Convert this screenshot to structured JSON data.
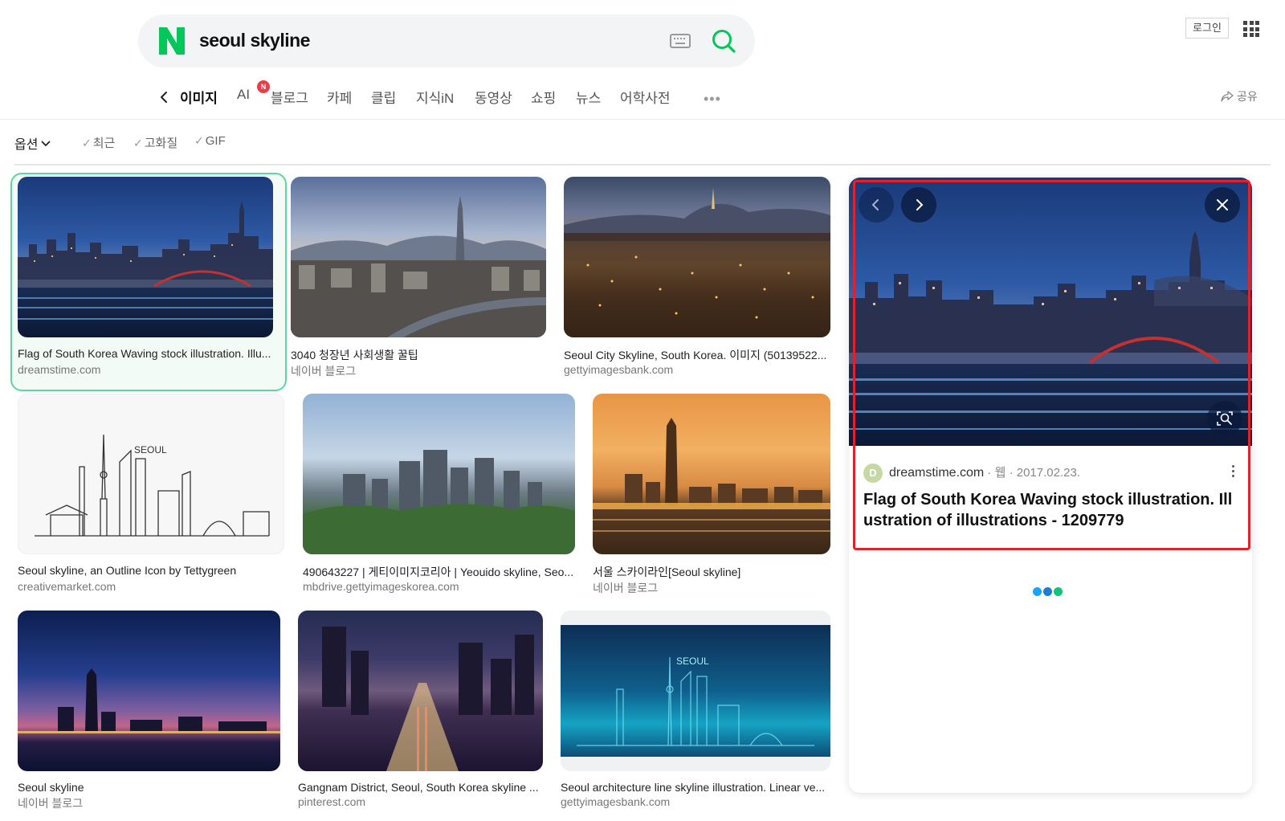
{
  "search": {
    "query": "seoul skyline",
    "keyboard_icon": "keyboard-icon",
    "search_icon": "search-icon"
  },
  "header": {
    "login_label": "로그인",
    "apps_icon": "apps-grid-icon"
  },
  "tabs": [
    {
      "label": "이미지",
      "active": true
    },
    {
      "label": "AI",
      "badge": "N"
    },
    {
      "label": "블로그"
    },
    {
      "label": "카페"
    },
    {
      "label": "클립"
    },
    {
      "label": "지식iN"
    },
    {
      "label": "동영상"
    },
    {
      "label": "쇼핑"
    },
    {
      "label": "뉴스"
    },
    {
      "label": "어학사전"
    }
  ],
  "share_label": "공유",
  "filters": {
    "options_label": "옵션",
    "checks": [
      "최근",
      "고화질",
      "GIF"
    ]
  },
  "results": [
    {
      "caption": "Flag of South Korea Waving stock illustration. Illu...",
      "source": "dreamstime.com"
    },
    {
      "caption": "3040 청장년 사회생활 꿀팁",
      "source": "네이버 블로그"
    },
    {
      "caption": "Seoul City Skyline, South Korea. 이미지 (50139522...",
      "source": "gettyimagesbank.com"
    },
    {
      "caption": "Seoul skyline, an Outline Icon by Tettygreen",
      "source": "creativemarket.com"
    },
    {
      "caption": "490643227 | 게티이미지코리아 | Yeouido skyline, Seo...",
      "source": "mbdrive.gettyimageskorea.com"
    },
    {
      "caption": "서울 스카이라인[Seoul skyline]",
      "source": "네이버 블로그"
    },
    {
      "caption": "Seoul skyline",
      "source": "네이버 블로그"
    },
    {
      "caption": "Gangnam District, Seoul, South Korea skyline ...",
      "source": "pinterest.com"
    },
    {
      "caption": "Seoul architecture line skyline illustration. Linear ve...",
      "source": "gettyimagesbank.com"
    }
  ],
  "illustration_text": {
    "outline": "SEOUL",
    "teal": "SEOUL"
  },
  "detail": {
    "site_initial": "D",
    "site": "dreamstime.com",
    "type": "웹",
    "date": "2017.02.23.",
    "title": "Flag of South Korea Waving stock illustration. Illustration of illustrations - 1209779"
  },
  "colors": {
    "brand": "#03c75a",
    "selection_border": "#5cd6a2",
    "highlight": "#e0232b",
    "loading": [
      "#1aa3ff",
      "#1a7fd4",
      "#14c27a"
    ]
  }
}
